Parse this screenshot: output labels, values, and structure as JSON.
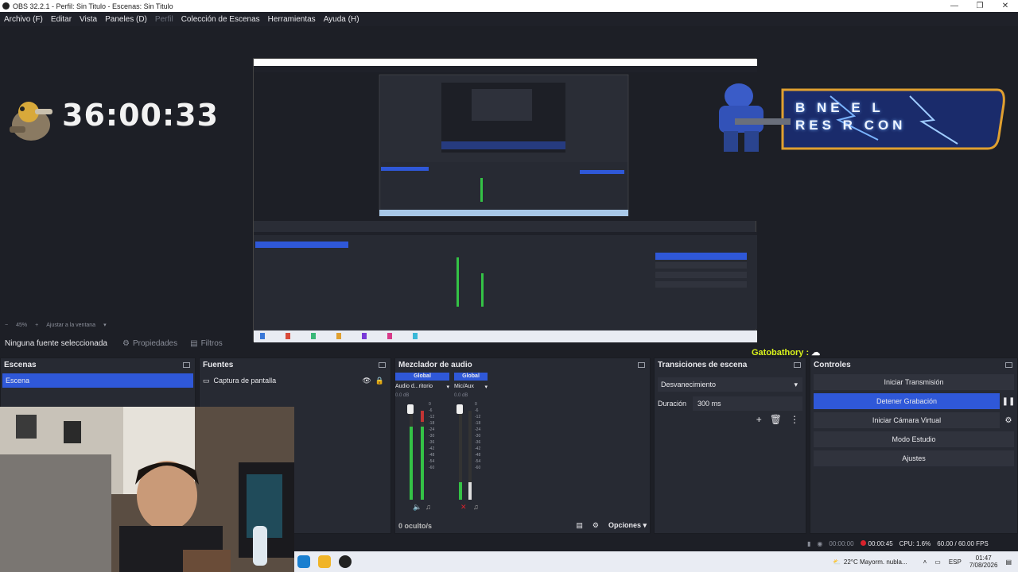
{
  "window": {
    "title": "OBS 32.2.1 - Perfil: Sin Titulo - Escenas: Sin Titulo",
    "controls": [
      "—",
      "❐",
      "✕"
    ]
  },
  "menu": [
    {
      "label": "Archivo (F)",
      "disabled": false
    },
    {
      "label": "Editar",
      "disabled": false
    },
    {
      "label": "Vista",
      "disabled": false
    },
    {
      "label": "Paneles (D)",
      "disabled": false
    },
    {
      "label": "Perfil",
      "disabled": true
    },
    {
      "label": "Colección de Escenas",
      "disabled": false
    },
    {
      "label": "Herramientas",
      "disabled": false
    },
    {
      "label": "Ayuda (H)",
      "disabled": false
    }
  ],
  "preview": {
    "timer": "36:00:33",
    "banner_line1": "B NE E L",
    "banner_line2": "RES R CON",
    "zoom_label": "45%",
    "fit_label": "Ajustar a la ventana"
  },
  "source_toolbar": {
    "no_source": "Ninguna fuente seleccionada",
    "properties": "Propiedades",
    "filters": "Filtros"
  },
  "chat_user": "Gatobathory :",
  "scenes": {
    "title": "Escenas",
    "items": [
      "Escena"
    ]
  },
  "sources": {
    "title": "Fuentes",
    "items": [
      "Captura de pantalla"
    ]
  },
  "mixer": {
    "title": "Mezclador de audio",
    "channels": [
      {
        "head": "Global",
        "name": "Audio d...ritorio",
        "db": "0.0 dB",
        "level": 0.82
      },
      {
        "head": "Global",
        "name": "Mic/Aux",
        "db": "0.0 dB",
        "level": 0.2
      }
    ],
    "scale": [
      "0",
      "-6",
      "-12",
      "-18",
      "-24",
      "-30",
      "-36",
      "-42",
      "-48",
      "-54",
      "-60"
    ],
    "hidden": "0 oculto/s",
    "options": "Opciones"
  },
  "transitions": {
    "title": "Transiciones de escena",
    "selected": "Desvanecimiento",
    "duration_label": "Duración",
    "duration_value": "300 ms"
  },
  "controls": {
    "title": "Controles",
    "start_stream": "Iniciar Transmisión",
    "stop_record": "Detener Grabación",
    "virtual_cam": "Iniciar Cámara Virtual",
    "studio_mode": "Modo Estudio",
    "settings": "Ajustes"
  },
  "status": {
    "stream_time": "00:00:00",
    "rec_time": "00:00:45",
    "cpu": "CPU: 1.6%",
    "fps": "60.00 / 60.00 FPS"
  },
  "taskbar": {
    "weather": "22°C  Mayorm. nubla...",
    "lang": "ESP",
    "time": "01:47",
    "date": "7/08/2026"
  },
  "colors": {
    "accent": "#2f58d8",
    "chat_name": "#d9f21c",
    "rec": "#d9222c"
  }
}
